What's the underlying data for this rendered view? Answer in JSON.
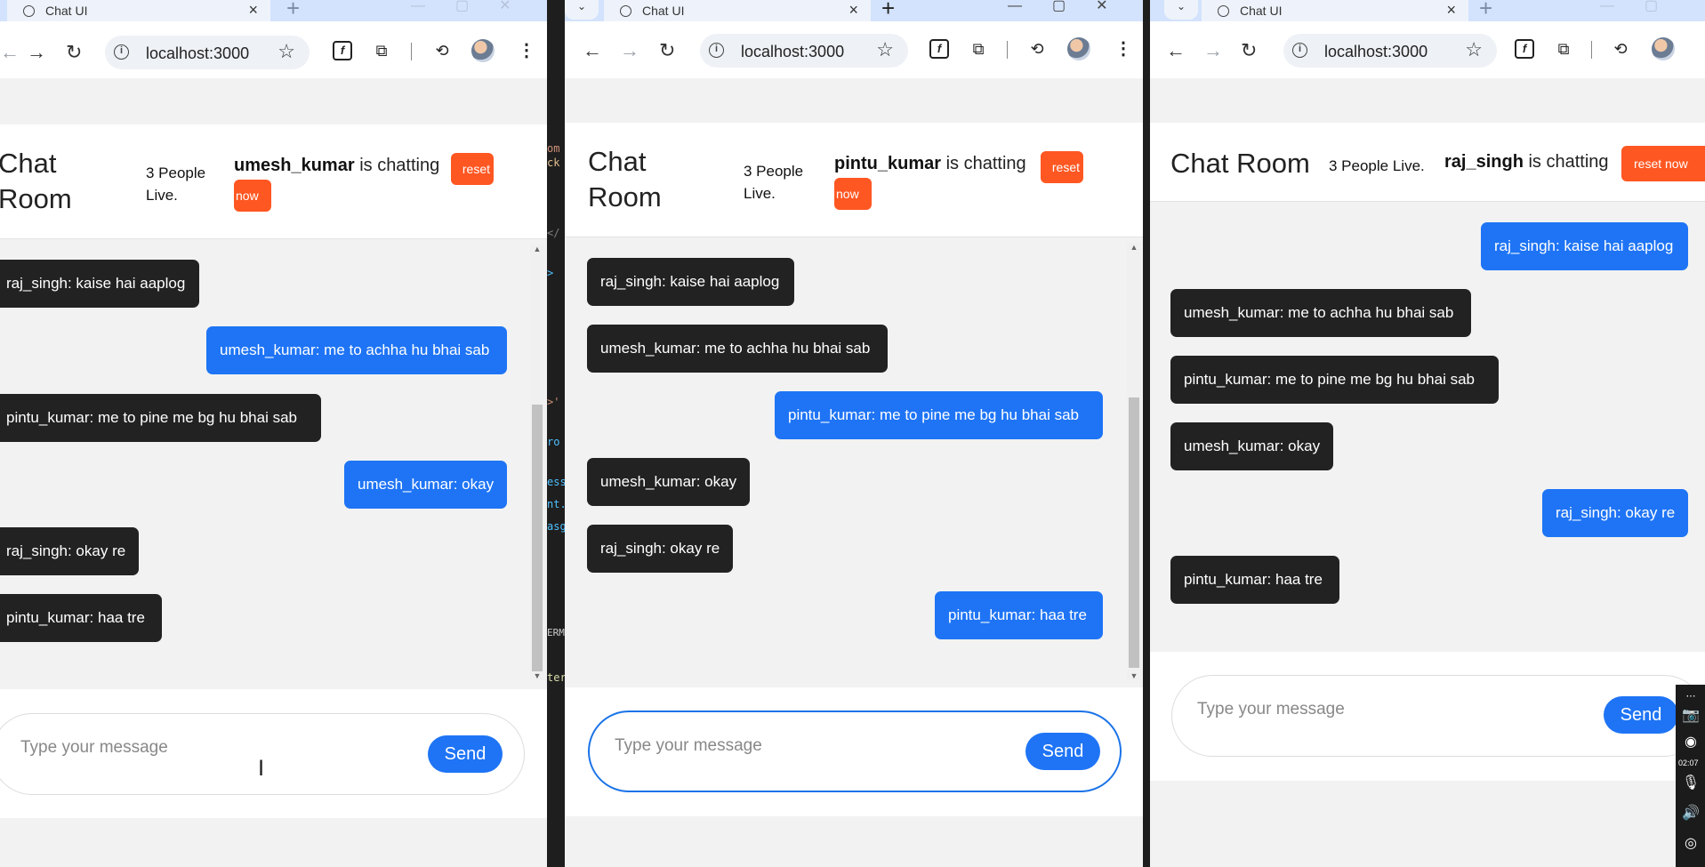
{
  "browser": {
    "tab_title": "Chat UI",
    "url": "localhost:3000",
    "new_tab": "+",
    "tab_close": "×"
  },
  "chat_title": "Chat Room",
  "chat_title_line1": "Chat",
  "chat_title_line2": "Room",
  "people_live": "3 People Live.",
  "people_line1": "3 People",
  "people_line2": "Live.",
  "chatting_suffix": "is chatting",
  "reset_label": "reset now",
  "reset_line1": "reset",
  "reset_line2": "now",
  "input_placeholder": "Type your message",
  "send_label": "Send",
  "windows": [
    {
      "user": "umesh_kumar",
      "messages": [
        {
          "text": "raj_singh: kaise hai aaplog",
          "own": false
        },
        {
          "text": "umesh_kumar: me to achha hu bhai sab",
          "own": true
        },
        {
          "text": "pintu_kumar: me to pine me bg hu bhai sab",
          "own": false
        },
        {
          "text": "umesh_kumar: okay",
          "own": true
        },
        {
          "text": "raj_singh: okay re",
          "own": false
        },
        {
          "text": "pintu_kumar: haa tre",
          "own": false
        }
      ]
    },
    {
      "user": "pintu_kumar",
      "messages": [
        {
          "text": "raj_singh: kaise hai aaplog",
          "own": false
        },
        {
          "text": "umesh_kumar: me to achha hu bhai sab",
          "own": false
        },
        {
          "text": "pintu_kumar: me to pine me bg hu bhai sab",
          "own": true
        },
        {
          "text": "umesh_kumar: okay",
          "own": false
        },
        {
          "text": "raj_singh: okay re",
          "own": false
        },
        {
          "text": "pintu_kumar: haa tre",
          "own": true
        }
      ]
    },
    {
      "user": "raj_singh",
      "messages": [
        {
          "text": "raj_singh: kaise hai aaplog",
          "own": true
        },
        {
          "text": "umesh_kumar: me to achha hu bhai sab",
          "own": false
        },
        {
          "text": "pintu_kumar: me to pine me bg hu bhai sab",
          "own": false
        },
        {
          "text": "umesh_kumar: okay",
          "own": false
        },
        {
          "text": "raj_singh: okay re",
          "own": true
        },
        {
          "text": "pintu_kumar: haa tre",
          "own": false
        }
      ]
    }
  ],
  "recorder_time": "02:07",
  "colors": {
    "own_bubble": "#1e74f5",
    "other_bubble": "#222222",
    "reset_button": "#ff5722",
    "send_button": "#1e74f5",
    "focus_ring": "#1a73e8"
  }
}
